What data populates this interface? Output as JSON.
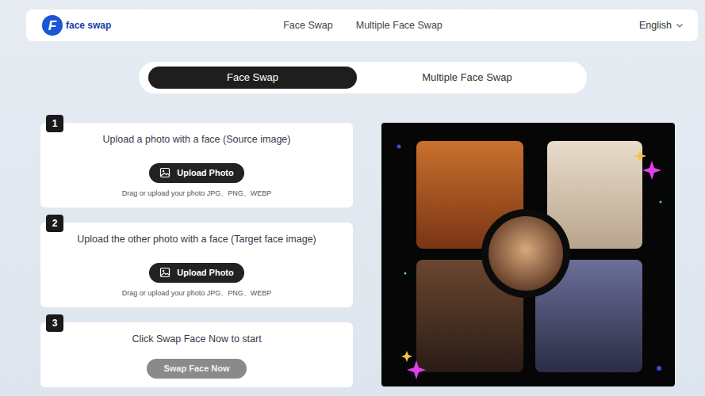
{
  "header": {
    "logo": {
      "mark": "F",
      "text": "face swap"
    },
    "nav": [
      {
        "label": "Face Swap"
      },
      {
        "label": "Multiple Face Swap"
      }
    ],
    "language": {
      "label": "English"
    }
  },
  "tabs": [
    {
      "label": "Face Swap",
      "selected": true
    },
    {
      "label": "Multiple Face Swap",
      "selected": false
    }
  ],
  "steps": [
    {
      "number": "1",
      "kind": "upload",
      "title": "Upload a photo with a face (Source image)",
      "button": "Upload Photo",
      "hint": "Drag or upload your photo JPG、PNG、WEBP",
      "disabled": false
    },
    {
      "number": "2",
      "kind": "upload",
      "title": "Upload the other photo with a face (Target face image)",
      "button": "Upload Photo",
      "hint": "Drag or upload your photo JPG、PNG、WEBP",
      "disabled": false
    },
    {
      "number": "3",
      "kind": "action",
      "title": "Click Swap Face Now to start",
      "button": "Swap Face Now",
      "disabled": true
    }
  ]
}
